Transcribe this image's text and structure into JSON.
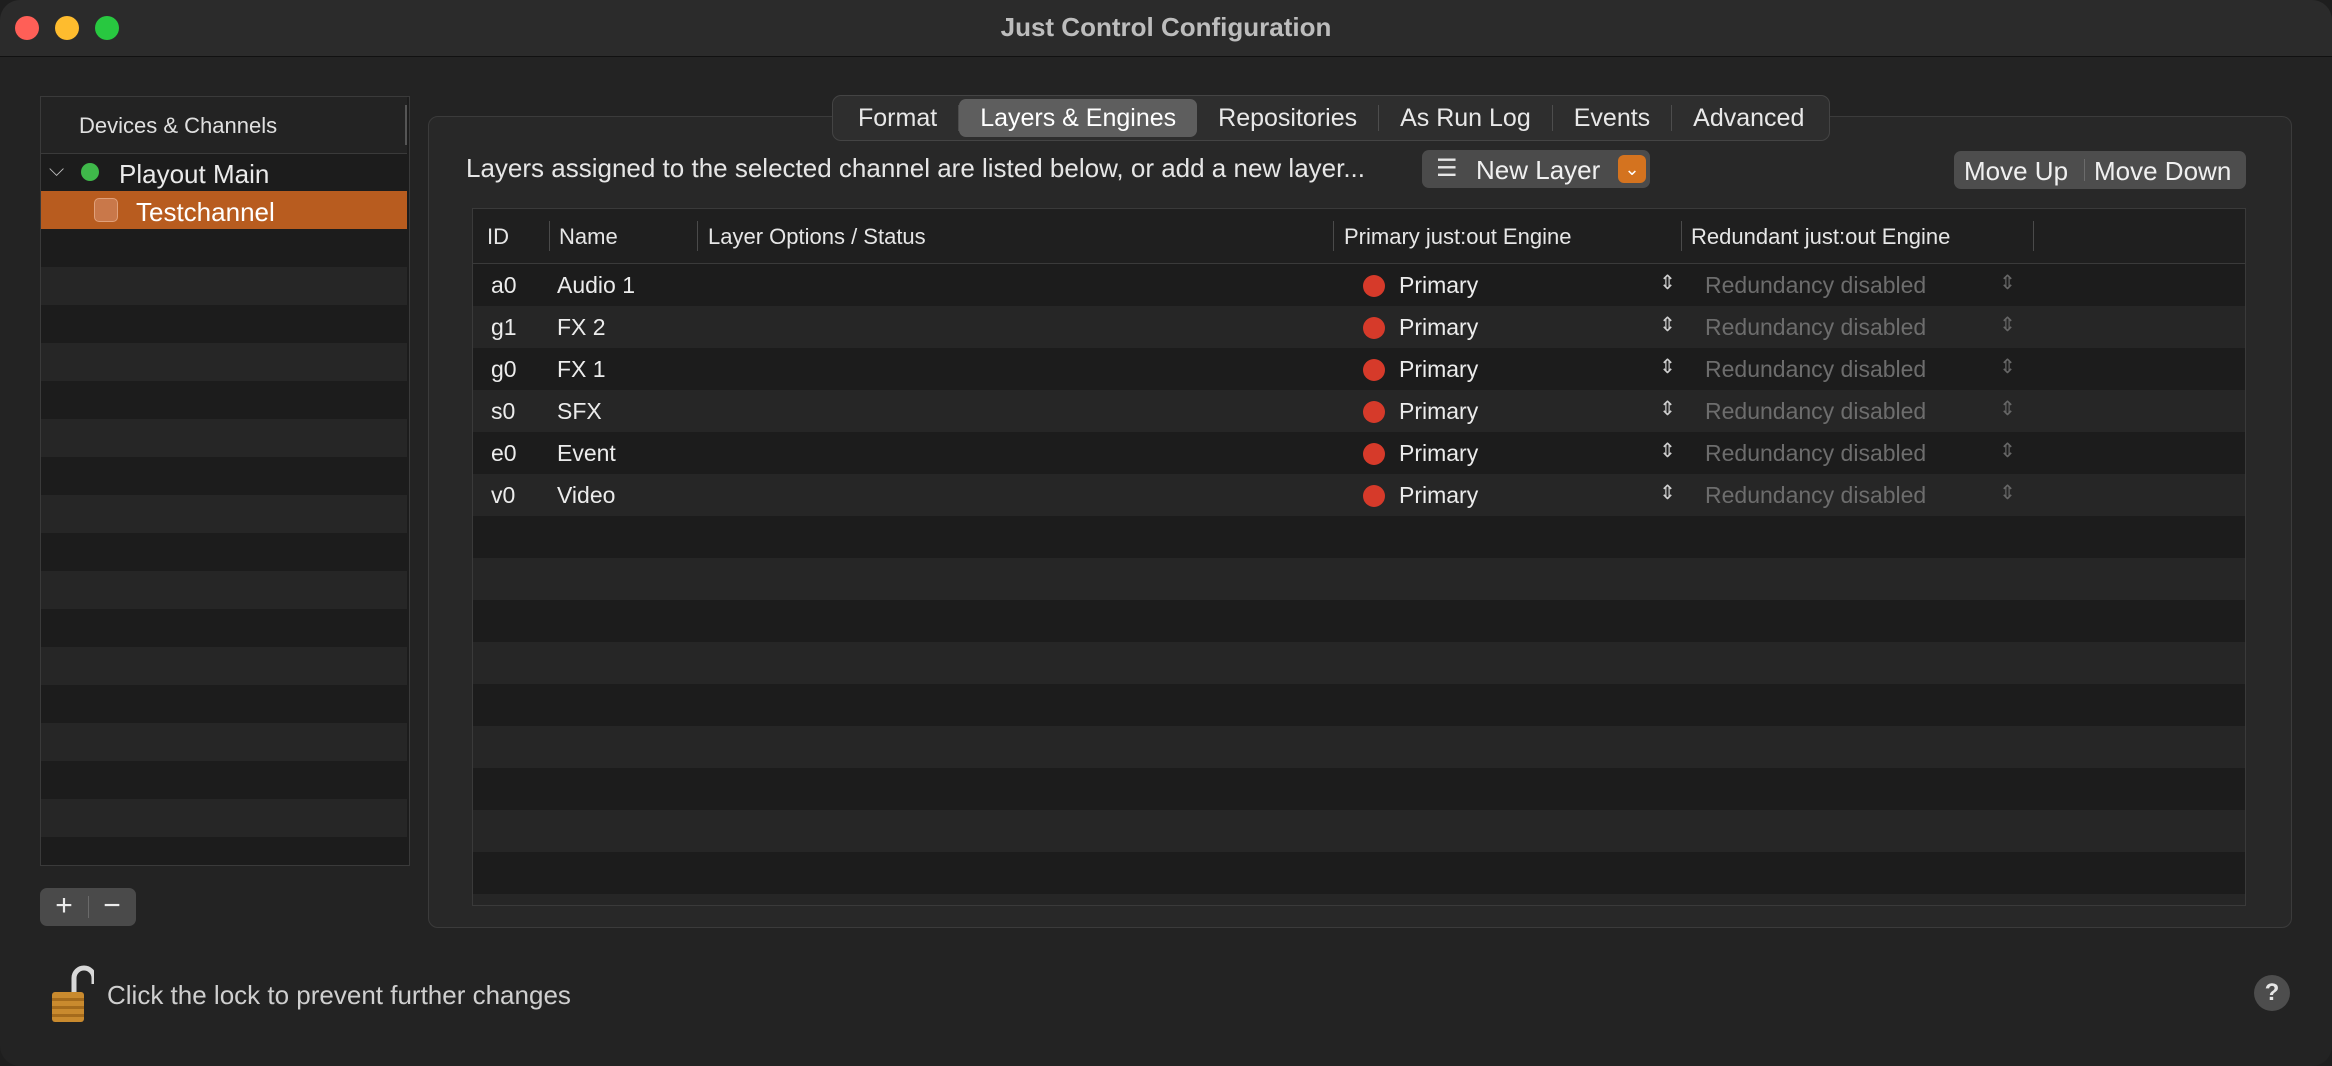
{
  "window": {
    "title": "Just Control Configuration"
  },
  "sidebar": {
    "header": "Devices & Channels",
    "items": [
      {
        "label": "Playout Main",
        "status_color": "#3fb84a"
      },
      {
        "label": "Testchannel",
        "selected": true
      }
    ],
    "add_label": "+",
    "remove_label": "−"
  },
  "tabs": [
    "Format",
    "Layers & Engines",
    "Repositories",
    "As Run Log",
    "Events",
    "Advanced"
  ],
  "active_tab": "Layers & Engines",
  "toolbar": {
    "instruction": "Layers assigned to the selected channel are listed below, or add a new layer...",
    "new_layer_label": "New Layer",
    "move_up_label": "Move Up",
    "move_down_label": "Move Down"
  },
  "table": {
    "columns": [
      "ID",
      "Name",
      "Layer Options / Status",
      "Primary just:out Engine",
      "Redundant just:out Engine"
    ],
    "rows": [
      {
        "id": "a0",
        "name": "Audio 1",
        "primary": "Primary",
        "redundant": "Redundancy disabled"
      },
      {
        "id": "g1",
        "name": "FX 2",
        "primary": "Primary",
        "redundant": "Redundancy disabled"
      },
      {
        "id": "g0",
        "name": "FX 1",
        "primary": "Primary",
        "redundant": "Redundancy disabled"
      },
      {
        "id": "s0",
        "name": "SFX",
        "primary": "Primary",
        "redundant": "Redundancy disabled"
      },
      {
        "id": "e0",
        "name": "Event",
        "primary": "Primary",
        "redundant": "Redundancy disabled"
      },
      {
        "id": "v0",
        "name": "Video",
        "primary": "Primary",
        "redundant": "Redundancy disabled"
      }
    ]
  },
  "footer": {
    "lock_text": "Click the lock to prevent further changes",
    "help_label": "?"
  },
  "colors": {
    "accent": "#d4731f",
    "selection": "#b85c1f",
    "primary_dot": "#d63a2a"
  }
}
